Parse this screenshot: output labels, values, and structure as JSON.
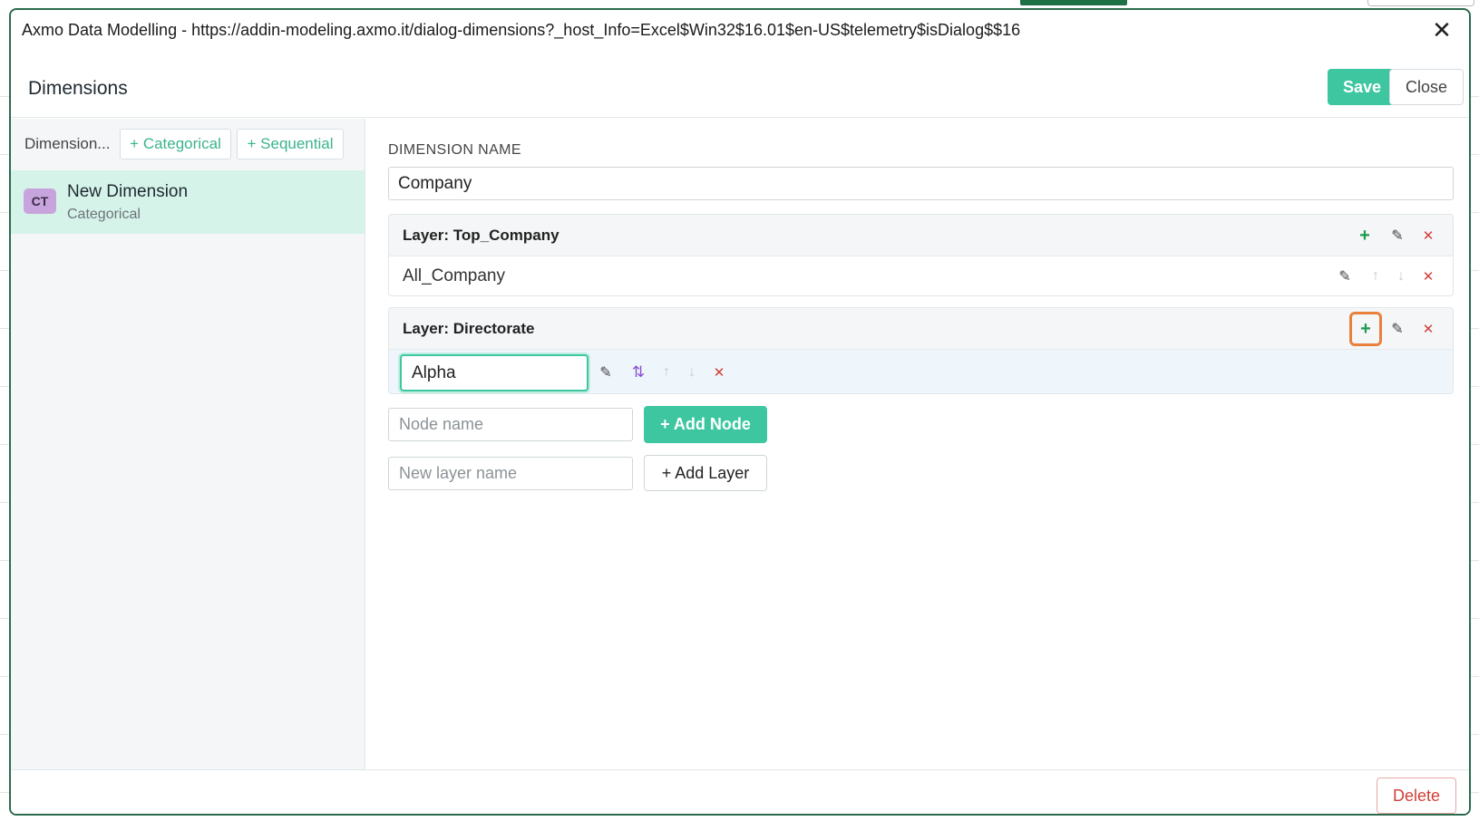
{
  "window": {
    "title": "Axmo Data Modelling - https://addin-modeling.axmo.it/dialog-dimensions?_host_Info=Excel$Win32$16.01$en-US$telemetry$isDialog$$16",
    "close_icon": "close-icon"
  },
  "header": {
    "title": "Dimensions",
    "save_label": "Save",
    "close_label": "Close"
  },
  "sidebar": {
    "label": "Dimension...",
    "add_categorical_label": "+ Categorical",
    "add_sequential_label": "+ Sequential",
    "items": [
      {
        "badge": "CT",
        "name": "New Dimension",
        "type": "Categorical",
        "selected": true
      }
    ]
  },
  "main": {
    "dimension_name_label": "DIMENSION NAME",
    "dimension_name_value": "Company",
    "layers": [
      {
        "title": "Layer: Top_Company",
        "nodes": [
          {
            "name": "All_Company"
          }
        ]
      },
      {
        "title": "Layer: Directorate",
        "editing_node_value": "Alpha",
        "add_node_highlighted": true
      }
    ],
    "node_name_placeholder": "Node name",
    "add_node_label": "+ Add Node",
    "layer_name_placeholder": "New layer name",
    "add_layer_label": "+ Add Layer"
  },
  "footer": {
    "delete_label": "Delete"
  },
  "colors": {
    "accent": "#3dc6a0",
    "highlight": "#e8813a",
    "danger": "#d0403a",
    "badge": "#c8a4dc",
    "selected_row": "#d6f3ea"
  }
}
